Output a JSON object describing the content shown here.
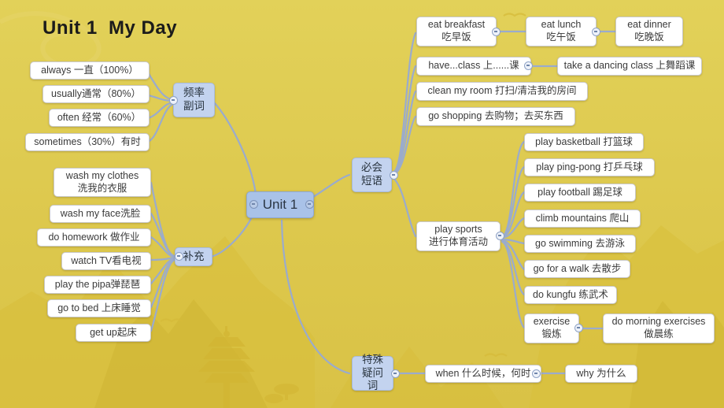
{
  "slide": {
    "title": "Unit 1  My Day",
    "background_color": "#ddc84d",
    "node_fill": "#ffffff",
    "branch_fill": "#c3d3ef",
    "root_fill": "#a9c2e8",
    "connector_color": "#9aabcd"
  },
  "root": {
    "label": "Unit 1"
  },
  "branches": {
    "adverbs": {
      "label": "频率\n副词",
      "children": [
        {
          "label": "always  一直（100%）"
        },
        {
          "label": "usually通常（80%）"
        },
        {
          "label": "often 经常（60%）"
        },
        {
          "label": "sometimes（30%）有时"
        }
      ]
    },
    "supplement": {
      "label": "补充",
      "children": [
        {
          "label": "wash my clothes\n洗我的衣服"
        },
        {
          "label": "wash my face洗脸"
        },
        {
          "label": "do homework 做作业"
        },
        {
          "label": "watch TV看电视"
        },
        {
          "label": "play the pipa弹琵琶"
        },
        {
          "label": "go to bed 上床睡觉"
        },
        {
          "label": "get  up起床"
        }
      ]
    },
    "phrases": {
      "label": "必会\n短语",
      "children": [
        {
          "label": "eat breakfast\n吃早饭"
        },
        {
          "label": "have...class 上......课"
        },
        {
          "label": "clean my room 打扫/清洁我的房间"
        },
        {
          "label": "go shopping 去购物；去买东西"
        },
        {
          "label": "play sports\n进行体育活动"
        }
      ],
      "grandchildren": {
        "eat_chain": [
          {
            "label": "eat  lunch\n吃午饭"
          },
          {
            "label": "eat dinner\n吃晚饭"
          }
        ],
        "class_chain": [
          {
            "label": "take a dancing class 上舞蹈课"
          }
        ],
        "sports": [
          {
            "label": "play  basketball 打篮球"
          },
          {
            "label": "play ping-pong 打乒乓球"
          },
          {
            "label": "play football 踢足球"
          },
          {
            "label": "climb mountains 爬山"
          },
          {
            "label": "go swimming 去游泳"
          },
          {
            "label": "go for a walk 去散步"
          },
          {
            "label": "do kungfu 练武术"
          },
          {
            "label": "exercise\n锻炼"
          }
        ],
        "exercise_chain": [
          {
            "label": "do morning exercises\n做晨练"
          }
        ]
      }
    },
    "question_words": {
      "label": "特殊\n疑问词",
      "children": [
        {
          "label": "when 什么时候，何时"
        }
      ],
      "grandchildren": [
        {
          "label": "why 为什么"
        }
      ]
    }
  }
}
